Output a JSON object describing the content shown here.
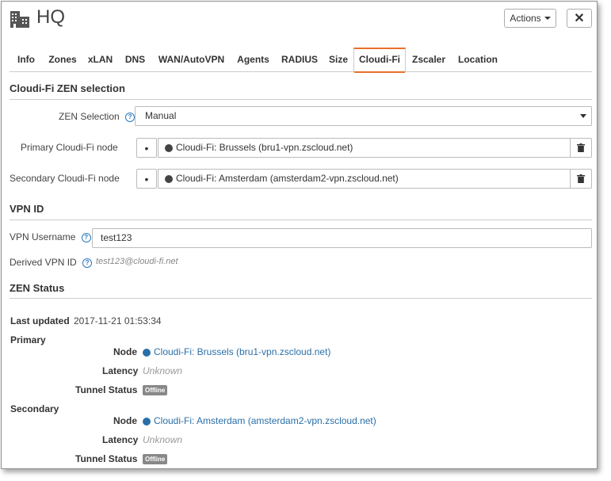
{
  "header": {
    "title": "HQ",
    "actions_label": "Actions",
    "close_symbol": "✕"
  },
  "tabs": [
    {
      "label": "Info"
    },
    {
      "label": "Zones"
    },
    {
      "label": "xLAN"
    },
    {
      "label": "DNS"
    },
    {
      "label": "WAN/AutoVPN"
    },
    {
      "label": "Agents"
    },
    {
      "label": "RADIUS"
    },
    {
      "label": "Size"
    },
    {
      "label": "Cloudi-Fi",
      "active": true
    },
    {
      "label": "Zscaler"
    },
    {
      "label": "Location"
    }
  ],
  "zen_selection_section": {
    "title": "Cloudi-Fi ZEN selection",
    "zen_selection_label": "ZEN Selection",
    "zen_selection_value": "Manual",
    "primary_label": "Primary Cloudi-Fi node",
    "primary_value": "Cloudi-Fi: Brussels (bru1-vpn.zscloud.net)",
    "secondary_label": "Secondary Cloudi-Fi node",
    "secondary_value": "Cloudi-Fi: Amsterdam (amsterdam2-vpn.zscloud.net)"
  },
  "vpn_section": {
    "title": "VPN ID",
    "username_label": "VPN Username",
    "username_value": "test123",
    "derived_label": "Derived VPN ID",
    "derived_value": "test123@cloudi-fi.net"
  },
  "zen_status": {
    "title": "ZEN Status",
    "last_updated_label": "Last updated",
    "last_updated_value": "2017-11-21 01:53:34",
    "primary": {
      "title": "Primary",
      "node_label": "Node",
      "node_value": "Cloudi-Fi: Brussels (bru1-vpn.zscloud.net)",
      "latency_label": "Latency",
      "latency_value": "Unknown",
      "tunnel_label": "Tunnel Status",
      "tunnel_value": "Offline"
    },
    "secondary": {
      "title": "Secondary",
      "node_label": "Node",
      "node_value": "Cloudi-Fi: Amsterdam (amsterdam2-vpn.zscloud.net)",
      "latency_label": "Latency",
      "latency_value": "Unknown",
      "tunnel_label": "Tunnel Status",
      "tunnel_value": "Offline"
    }
  },
  "icons": {
    "header": "building-icon",
    "help": "help-circle-icon",
    "globe": "globe-icon",
    "trash": "trash-icon"
  },
  "colors": {
    "active_tab_accent": "#e8712a",
    "link": "#2a6fa8",
    "help": "#2a7bbf",
    "offline_badge": "#888888"
  }
}
